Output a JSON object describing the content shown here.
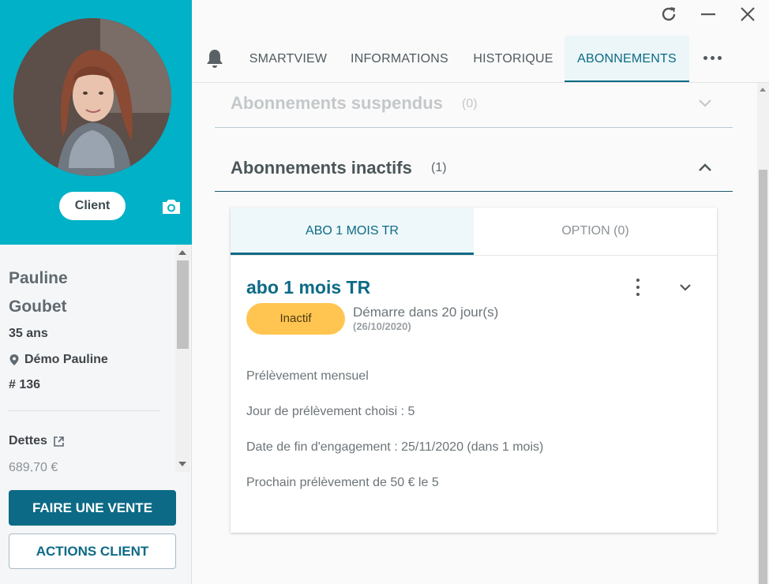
{
  "profile": {
    "role": "Client",
    "first_name": "Pauline",
    "last_name": "Goubet",
    "age": "35 ans",
    "location": "Démo Pauline",
    "member_number": "# 136",
    "debts_label": "Dettes",
    "debts_value": "689,70 €"
  },
  "actions": {
    "sale": "FAIRE UNE VENTE",
    "client_actions": "ACTIONS CLIENT"
  },
  "tabs": [
    {
      "label": "SMARTVIEW"
    },
    {
      "label": "INFORMATIONS"
    },
    {
      "label": "HISTORIQUE"
    },
    {
      "label": "ABONNEMENTS",
      "active": true
    }
  ],
  "sections": {
    "suspended": {
      "title": "Abonnements suspendus",
      "count": "(0)"
    },
    "inactive": {
      "title": "Abonnements inactifs",
      "count": "(1)"
    }
  },
  "card": {
    "tabs": [
      "ABO 1 MOIS TR",
      "OPTION (0)"
    ],
    "title": "abo 1 mois TR",
    "status": "Inactif",
    "start_text": "Démarre dans 20 jour(s)",
    "start_date": "(26/10/2020)",
    "details": [
      "Prélèvement mensuel",
      "Jour de prélèvement choisi : 5",
      "Date de fin d'engagement : 25/11/2020 (dans 1 mois)",
      "Prochain prélèvement de 50 € le 5"
    ]
  },
  "icons": {
    "refresh": "refresh-icon",
    "minimize": "minimize-icon",
    "close": "close-icon",
    "bell": "bell-icon",
    "more": "more-icon",
    "camera": "camera-icon",
    "pin": "location-pin-icon",
    "external": "external-link-icon"
  },
  "colors": {
    "header_bg": "#00b1c7",
    "primary": "#0c6a86",
    "status_badge": "#ffc550"
  }
}
